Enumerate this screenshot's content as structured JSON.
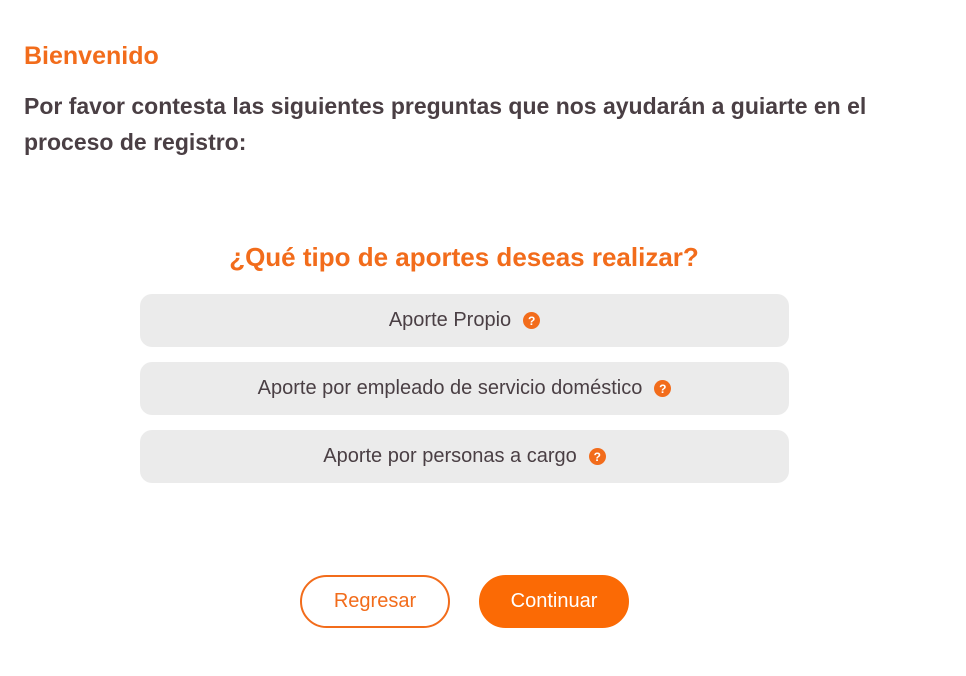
{
  "header": {
    "title": "Bienvenido",
    "intro": "Por favor contesta las siguientes preguntas que nos ayudarán a guiarte en el proceso de registro:"
  },
  "question": {
    "title": "¿Qué tipo de aportes deseas realizar?",
    "options": [
      {
        "label": "Aporte Propio",
        "help_icon": "question-circle-icon"
      },
      {
        "label": "Aporte por empleado de servicio doméstico",
        "help_icon": "question-circle-icon"
      },
      {
        "label": "Aporte por personas a cargo",
        "help_icon": "question-circle-icon"
      }
    ],
    "help_glyph": "?"
  },
  "actions": {
    "back_label": "Regresar",
    "continue_label": "Continuar"
  },
  "colors": {
    "accent": "#f26c1b",
    "primary_button": "#fb6a05",
    "text": "#4a3f44",
    "option_bg": "#ebebeb"
  }
}
